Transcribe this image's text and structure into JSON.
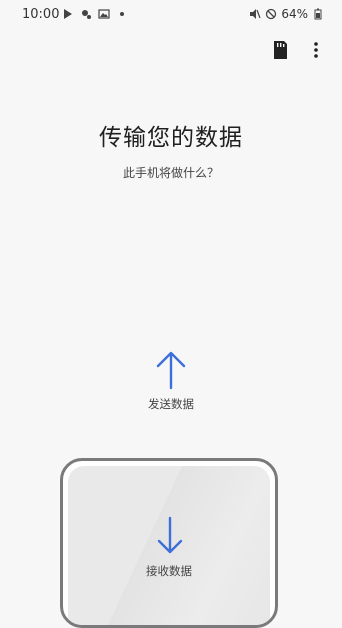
{
  "status_bar": {
    "time": "10:00",
    "battery": "64%"
  },
  "title": "传输您的数据",
  "subtitle": "此手机将做什么？",
  "actions": {
    "send_label": "发送数据",
    "receive_label": "接收数据"
  },
  "colors": {
    "accent": "#3e6fd8",
    "background": "#f7f7f7"
  }
}
